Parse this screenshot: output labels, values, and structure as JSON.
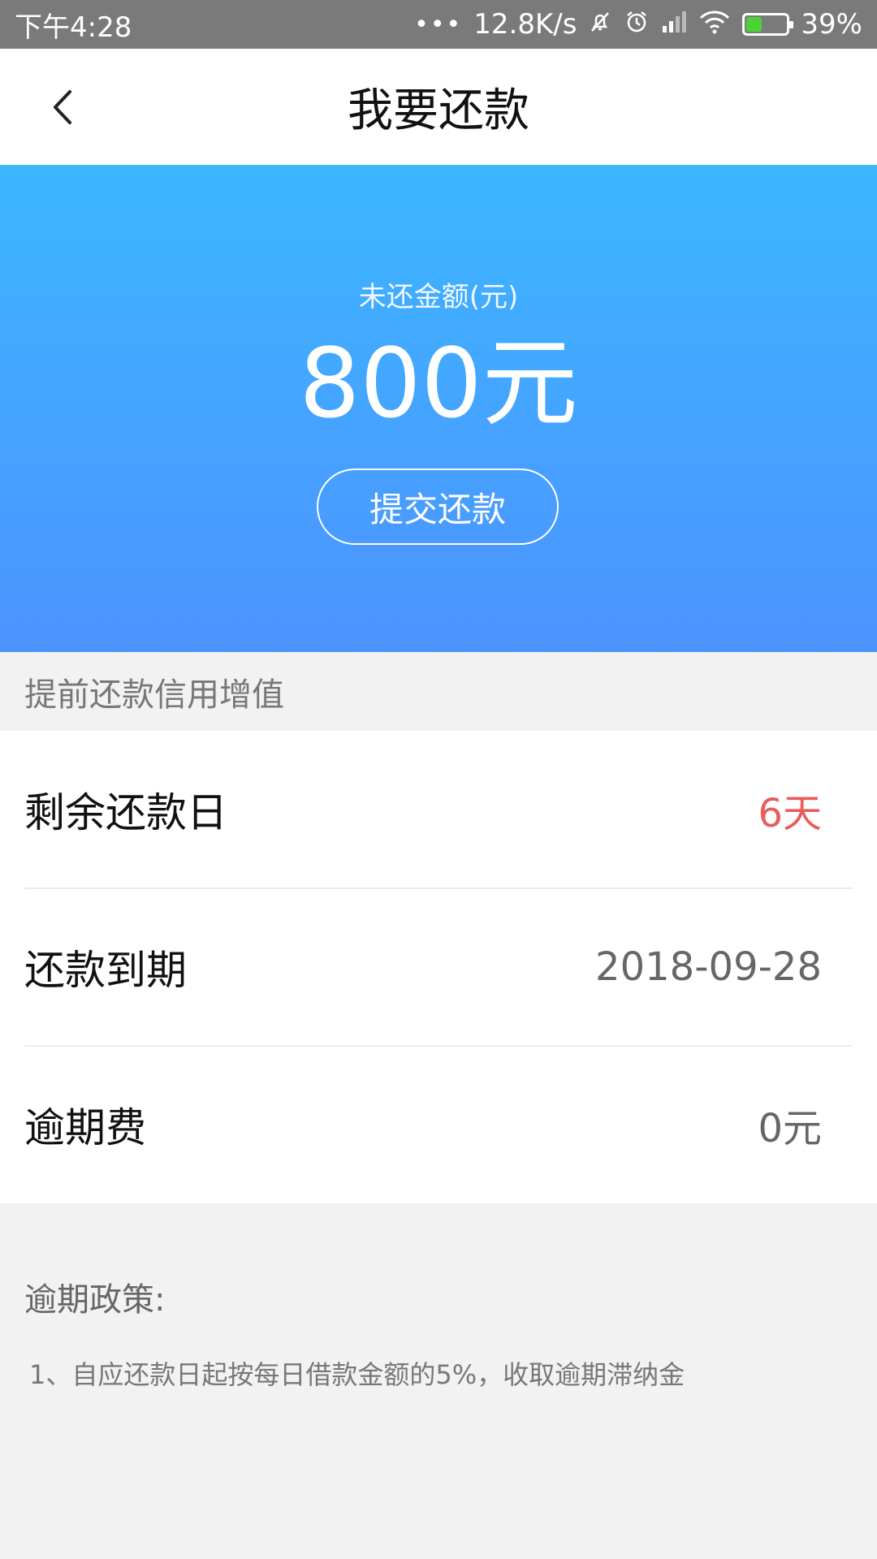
{
  "status_bar": {
    "time": "下午4:28",
    "dots": "•••",
    "net_speed": "12.8K/s",
    "battery_percent": "39%",
    "battery_level": 0.39,
    "icons": [
      "mute-icon",
      "alarm-icon",
      "signal-icon",
      "wifi-icon",
      "battery-charging-icon"
    ]
  },
  "nav": {
    "title": "我要还款",
    "back_icon": "chevron-left-icon"
  },
  "hero": {
    "label": "未还金额(元)",
    "amount": "800元",
    "submit_label": "提交还款",
    "gradient_top": "#3cb6ff",
    "gradient_bottom": "#4d93ff"
  },
  "section": {
    "header": "提前还款信用增值"
  },
  "info": {
    "rows": [
      {
        "label": "剩余还款日",
        "value": "6天",
        "value_color": "#e85d5d"
      },
      {
        "label": "还款到期",
        "value": "2018-09-28"
      },
      {
        "label": "逾期费",
        "value": "0元"
      }
    ]
  },
  "policy": {
    "title": "逾期政策:",
    "items": [
      "1、自应还款日起按每日借款金额的5%，收取逾期滞纳金"
    ]
  }
}
